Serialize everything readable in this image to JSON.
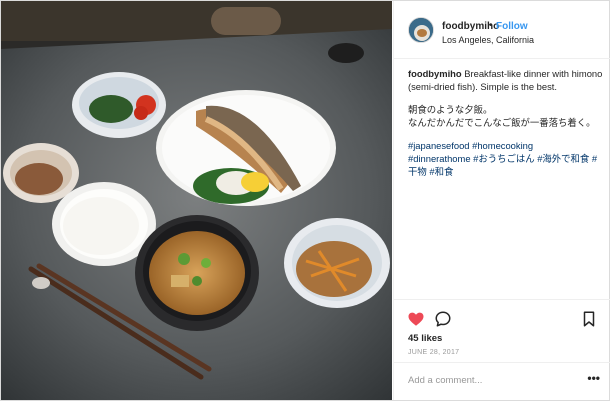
{
  "post": {
    "username": "foodbymiho",
    "follow_separator": "•",
    "follow_label": "Follow",
    "location": "Los Angeles, California",
    "caption": {
      "username": "foodbymiho",
      "text_en": "Breakfast-like dinner with himono (semi-dried fish). Simple is the best.",
      "text_jp_line1": "朝食のような夕飯。",
      "text_jp_line2": "なんだかんだでこんなご飯が一番落ち着く。",
      "hashtags_line1": "#japanesefood #homecooking",
      "hashtags_line2": "#dinnerathome #おうちごはん #海外で和食 #",
      "hashtags_line3": "干物 #和食"
    },
    "likes": "45 likes",
    "date": "JUNE 28, 2017",
    "comment_placeholder": "Add a comment...",
    "more_label": "•••"
  },
  "icons": {
    "like": "heart-icon",
    "comment": "comment-bubble-icon",
    "save": "bookmark-icon",
    "more": "more-options-icon"
  },
  "colors": {
    "heart": "#ed4956",
    "link": "#003569",
    "follow": "#3897f0"
  }
}
